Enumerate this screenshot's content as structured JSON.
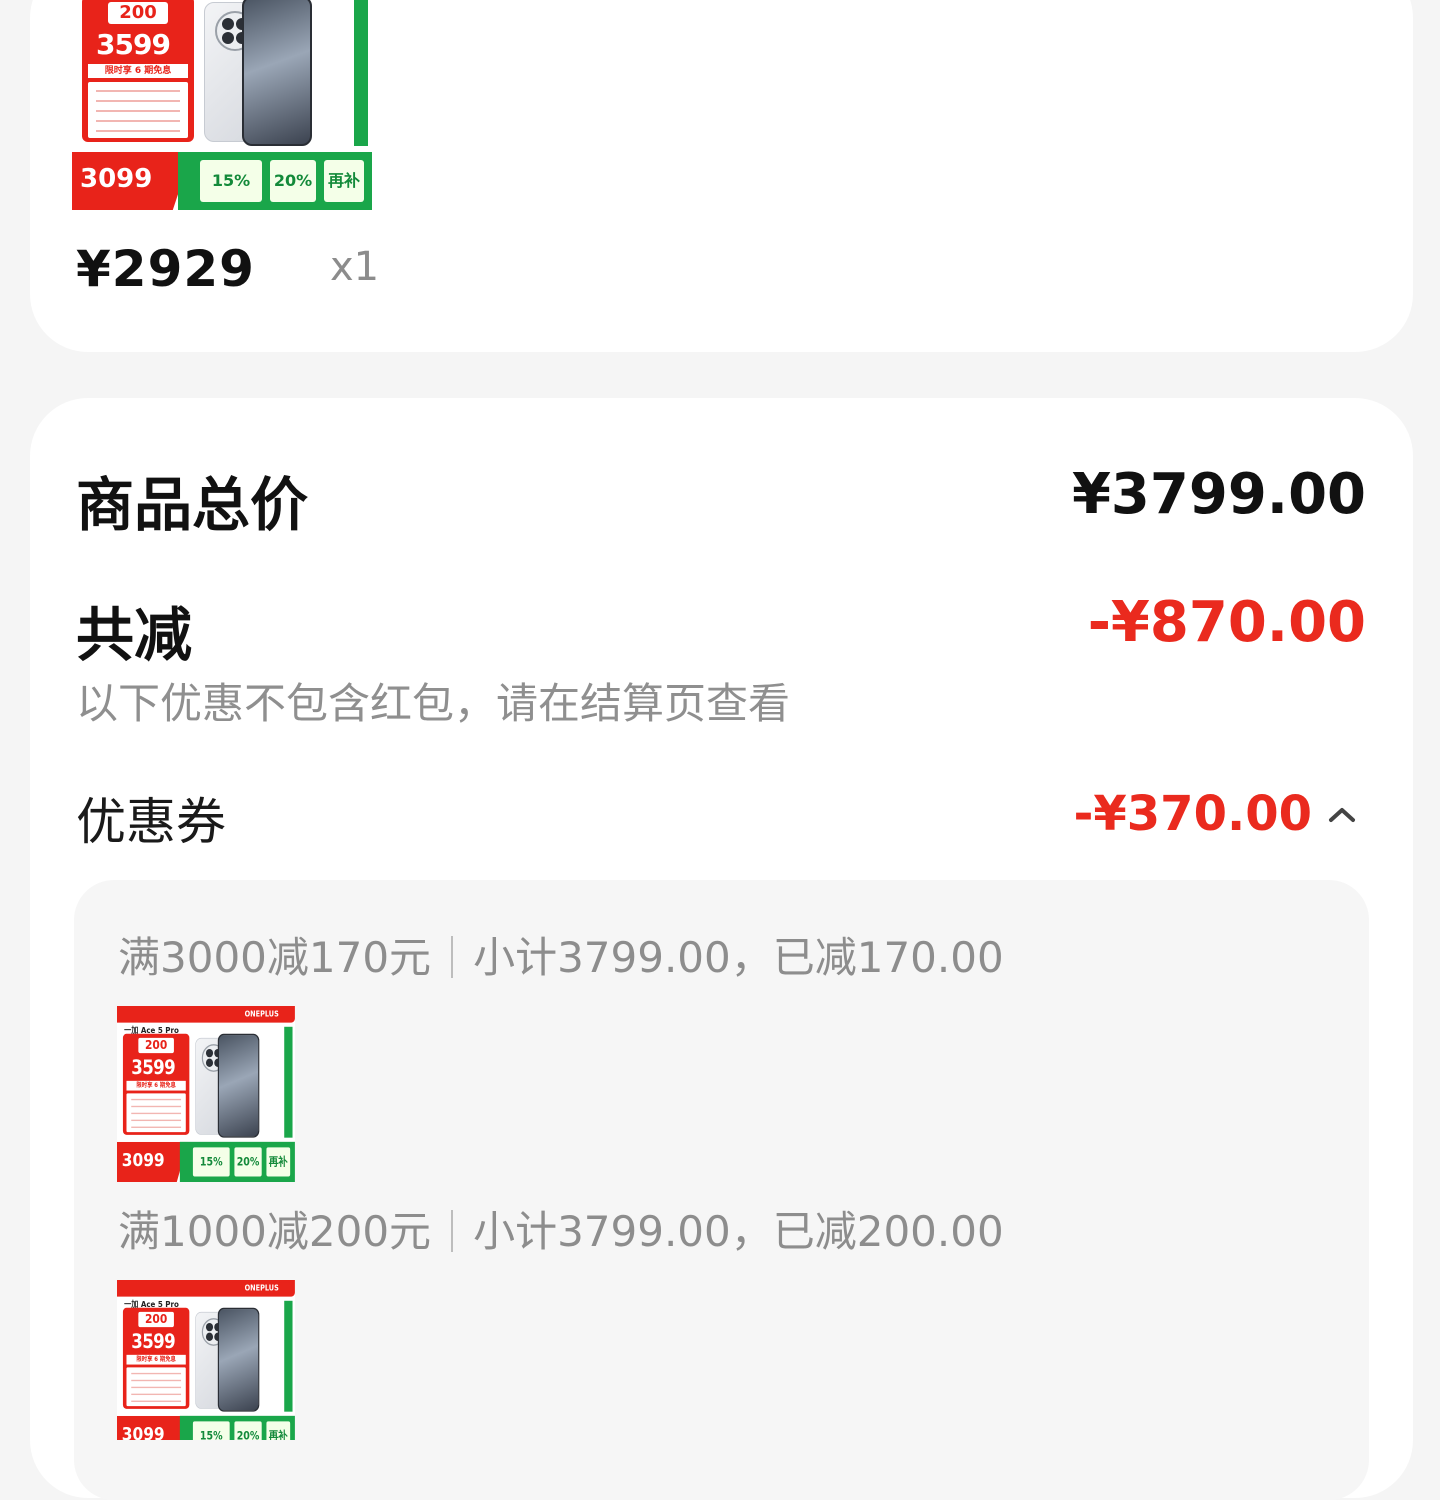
{
  "order_item": {
    "price": "¥2929",
    "quantity": "x1",
    "thumbnail": {
      "brand": "ONEPLUS",
      "model": "一加 Ace 5 Pro",
      "promo_amount": "200",
      "price": "3599",
      "tagline": "限时享 6 期免息",
      "subsidy_price": "3099",
      "badge_15": "15%",
      "badge_20": "20%",
      "badge_extra": "再补"
    }
  },
  "summary": {
    "total_label": "商品总价",
    "total_value": "¥3799.00",
    "reduce_label": "共减",
    "reduce_value": "-¥870.00",
    "note": "以下优惠不包含红包，请在结算页查看",
    "coupon_label": "优惠券",
    "coupon_value": "-¥370.00"
  },
  "coupons": [
    {
      "rule": "满3000减170元",
      "detail": "小计3799.00，已减170.00"
    },
    {
      "rule": "满1000减200元",
      "detail": "小计3799.00，已减200.00"
    }
  ],
  "colors": {
    "accent_red": "#ea2a1e",
    "promo_red": "#e8231a",
    "promo_green": "#1aa64a"
  }
}
